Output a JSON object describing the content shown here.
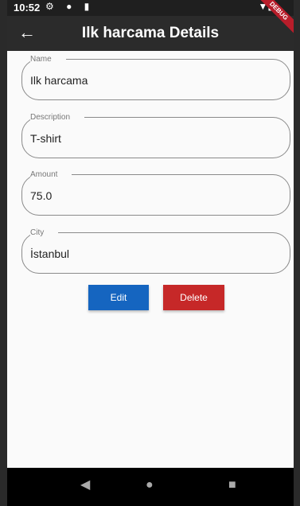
{
  "status_bar": {
    "time": "10:52",
    "icons": "⚙ ● ▮",
    "right_icons": "▼▮"
  },
  "app_bar": {
    "back_icon": "←",
    "title": "Ilk harcama Details",
    "debug_banner": "DEBUG"
  },
  "fields": {
    "name": {
      "label": "Name",
      "value": "Ilk harcama"
    },
    "description": {
      "label": "Description",
      "value": "T-shirt"
    },
    "amount": {
      "label": "Amount",
      "value": "75.0"
    },
    "city": {
      "label": "City",
      "value": "İstanbul"
    }
  },
  "buttons": {
    "edit": {
      "label": "Edit",
      "color": "#1565c0"
    },
    "delete": {
      "label": "Delete",
      "color": "#c62828"
    }
  },
  "nav_bar": {
    "back": "◀",
    "home": "●",
    "recents": "■"
  }
}
